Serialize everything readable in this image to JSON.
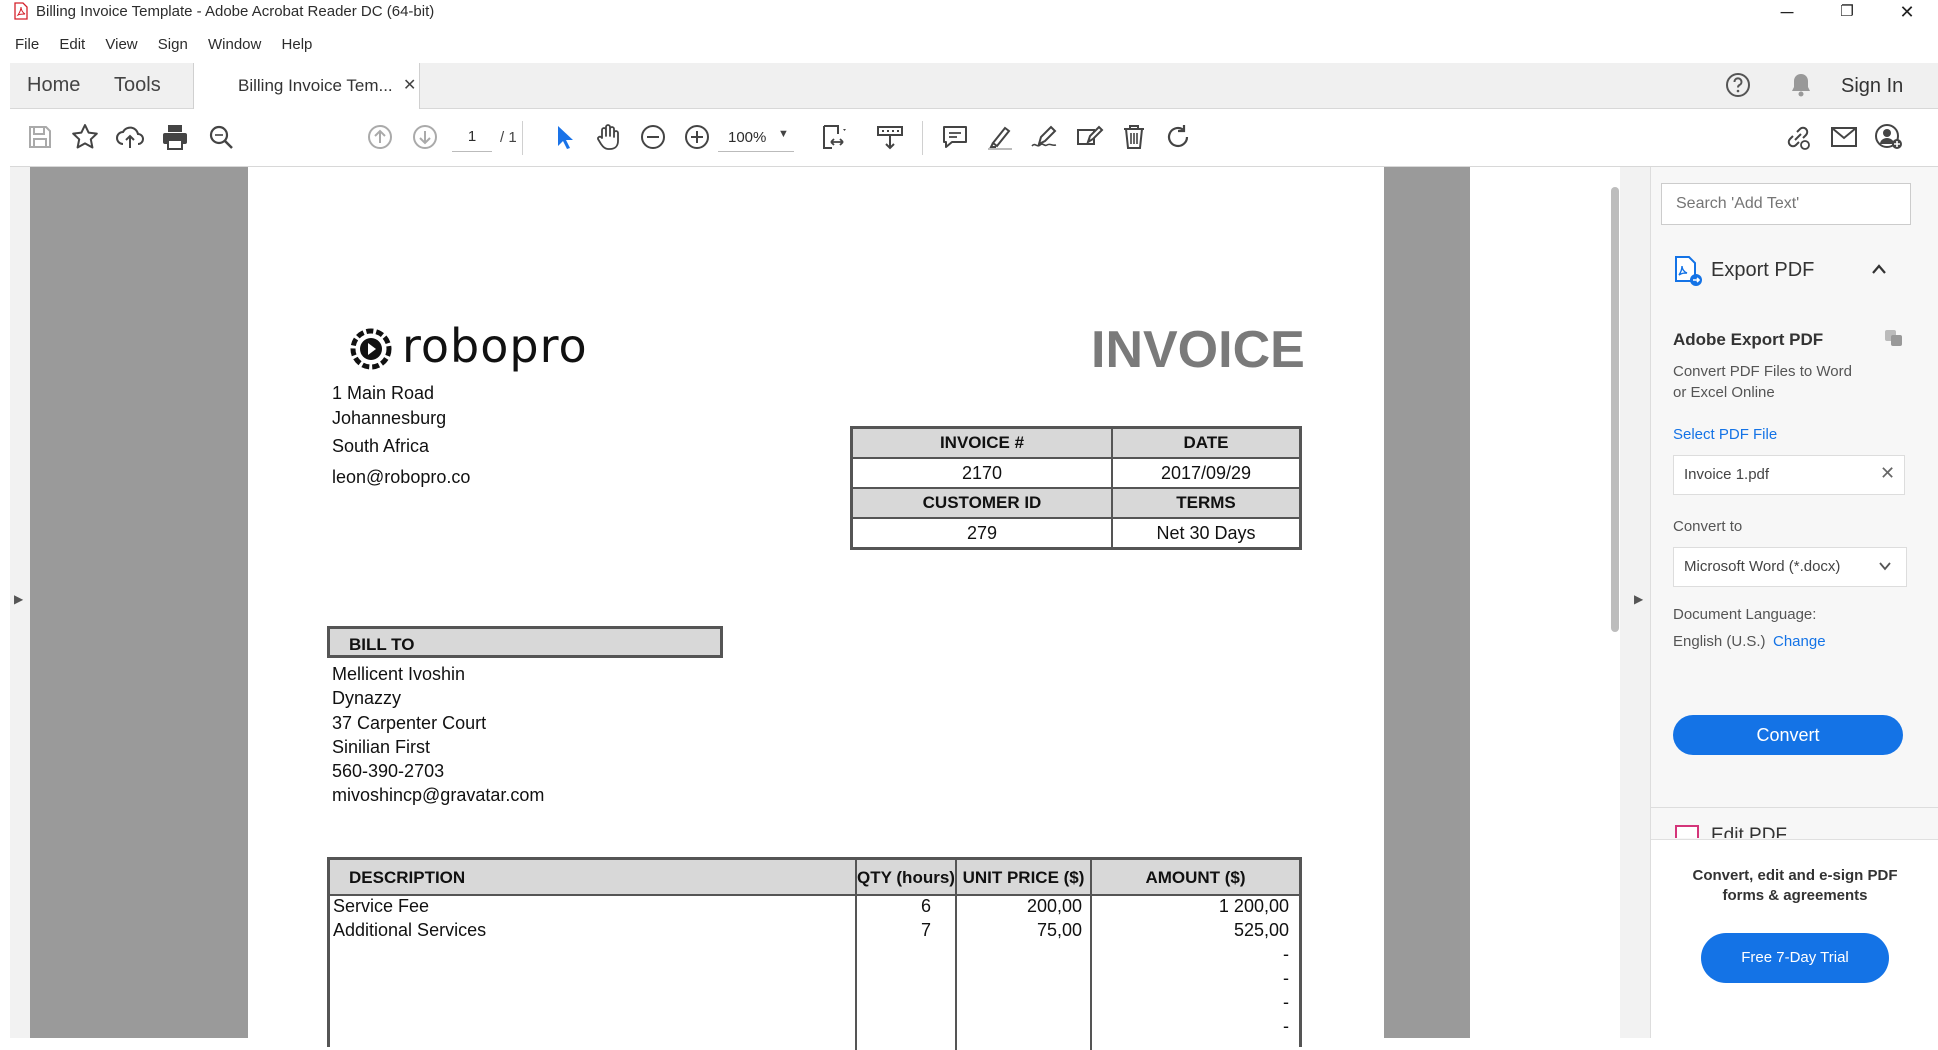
{
  "window": {
    "title": "Billing Invoice Template - Adobe Acrobat Reader DC (64-bit)",
    "controls": {
      "minimize": "─",
      "maximize": "❐",
      "close": "✕"
    }
  },
  "menu": [
    "File",
    "Edit",
    "View",
    "Sign",
    "Window",
    "Help"
  ],
  "tabs": {
    "home": "Home",
    "tools": "Tools",
    "document": "Billing Invoice Tem...",
    "close": "✕",
    "sign_in": "Sign In"
  },
  "toolbar": {
    "page_current": "1",
    "page_total": "/ 1",
    "zoom": "100%"
  },
  "invoice": {
    "logo_text": "robopro",
    "heading": "INVOICE",
    "company_address": [
      "1 Main Road",
      "Johannesburg",
      "South Africa",
      "leon@robopro.co"
    ],
    "meta": {
      "invoice_no_label": "INVOICE #",
      "date_label": "DATE",
      "invoice_no": "2170",
      "date": "2017/09/29",
      "customer_id_label": "CUSTOMER ID",
      "terms_label": "TERMS",
      "customer_id": "279",
      "terms": "Net 30 Days"
    },
    "bill_to_label": "BILL TO",
    "bill_to": [
      "Mellicent Ivoshin",
      "Dynazzy",
      "37 Carpenter Court",
      "Sinilian First",
      "560-390-2703",
      "mivoshincp@gravatar.com"
    ],
    "items_columns": [
      "DESCRIPTION",
      "QTY (hours)",
      "UNIT PRICE ($)",
      "AMOUNT ($)"
    ],
    "items": [
      {
        "description": "Service Fee",
        "qty": "6",
        "unit_price": "200,00",
        "amount": "1 200,00"
      },
      {
        "description": "Additional Services",
        "qty": "7",
        "unit_price": "75,00",
        "amount": "525,00"
      },
      {
        "description": "",
        "qty": "",
        "unit_price": "",
        "amount": "-"
      },
      {
        "description": "",
        "qty": "",
        "unit_price": "",
        "amount": "-"
      },
      {
        "description": "",
        "qty": "",
        "unit_price": "",
        "amount": "-"
      },
      {
        "description": "",
        "qty": "",
        "unit_price": "",
        "amount": "-"
      }
    ]
  },
  "right_panel": {
    "search_placeholder": "Search 'Add Text'",
    "export_title": "Export PDF",
    "adobe_export_title": "Adobe Export PDF",
    "adobe_export_desc_1": "Convert PDF Files to Word",
    "adobe_export_desc_2": "or Excel Online",
    "select_file_label": "Select PDF File",
    "selected_file": "Invoice 1.pdf",
    "convert_to_label": "Convert to",
    "convert_to_value": "Microsoft Word (*.docx)",
    "doc_lang_label": "Document Language:",
    "doc_lang_value": "English (U.S.)",
    "change_link": "Change",
    "convert_button": "Convert",
    "edit_pdf_partial": "Edit PDF",
    "promo_line_1": "Convert, edit and e-sign PDF",
    "promo_line_2": "forms & agreements",
    "trial_button": "Free 7-Day Trial"
  },
  "colors": {
    "accent_blue": "#1473e6",
    "pointer_blue": "#1a73e8",
    "table_header_grey": "#d8d8d8",
    "doc_background": "#9a9a9a"
  }
}
